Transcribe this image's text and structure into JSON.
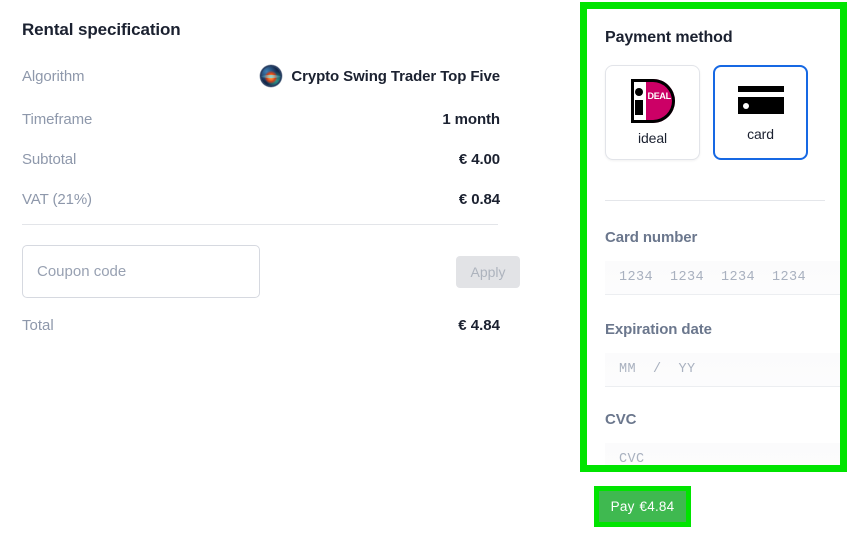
{
  "rental": {
    "title": "Rental specification",
    "rows": [
      {
        "label": "Algorithm",
        "value": "Crypto Swing Trader Top Five",
        "icon": "crypto-coin-icon"
      },
      {
        "label": "Timeframe",
        "value": "1 month"
      },
      {
        "label": "Subtotal",
        "value": "€ 4.00"
      },
      {
        "label": "VAT (21%)",
        "value": "€ 0.84"
      }
    ],
    "coupon": {
      "placeholder": "Coupon code",
      "value": "",
      "apply_label": "Apply"
    },
    "total": {
      "label": "Total",
      "value": "€ 4.84"
    }
  },
  "payment": {
    "title": "Payment method",
    "methods": [
      {
        "id": "ideal",
        "label": "ideal",
        "icon": "ideal-logo-icon",
        "selected": false
      },
      {
        "id": "card",
        "label": "card",
        "icon": "credit-card-icon",
        "selected": true
      }
    ],
    "fields": [
      {
        "id": "card-number",
        "label": "Card number",
        "placeholder": "1234  1234  1234  1234",
        "value": ""
      },
      {
        "id": "expiration",
        "label": "Expiration date",
        "placeholder": "MM  /  YY",
        "value": ""
      },
      {
        "id": "cvc",
        "label": "CVC",
        "placeholder": "CVC",
        "value": ""
      }
    ],
    "ideal_logo_text": "DEAL"
  },
  "pay_button": {
    "label": "Pay",
    "amount": "€4.84"
  },
  "colors": {
    "annotation_green": "#00e400",
    "pay_button_green": "#3fb950",
    "selected_border_blue": "#1668e3",
    "ideal_magenta": "#cc0066",
    "label_gray": "#8e98ab",
    "text_dark": "#1b2130"
  }
}
